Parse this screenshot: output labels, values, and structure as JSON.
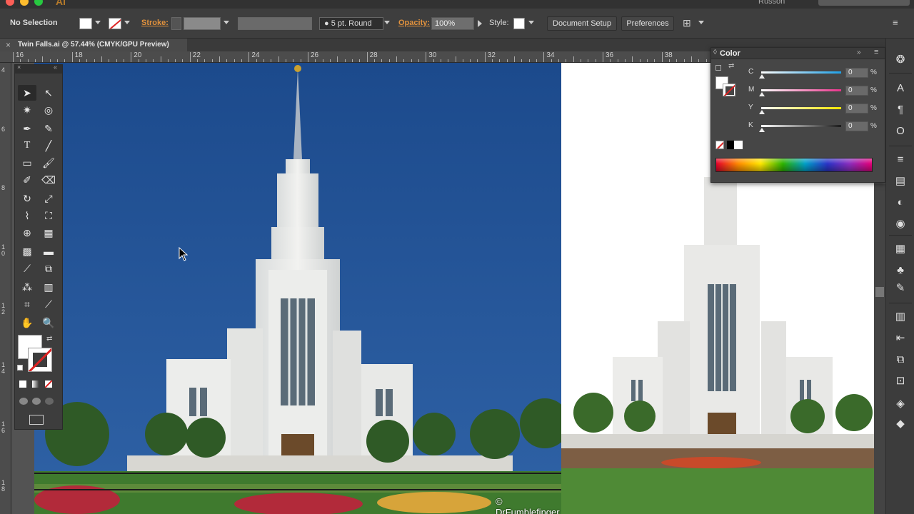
{
  "menubar": {
    "app_logo": "Ai",
    "user": "Russon"
  },
  "controlbar": {
    "selection": "No Selection",
    "stroke_label": "Stroke:",
    "brush": "5 pt. Round",
    "opacity_label": "Opacity:",
    "opacity_value": "100%",
    "style_label": "Style:",
    "document_setup": "Document Setup",
    "preferences": "Preferences"
  },
  "document": {
    "tab_title": "Twin Falls.ai @ 57.44% (CMYK/GPU Preview)",
    "close": "×"
  },
  "ruler": {
    "h_labels": [
      "16",
      "18",
      "20",
      "22",
      "24",
      "26",
      "28",
      "30",
      "32",
      "34",
      "36",
      "38"
    ],
    "v_labels": [
      "4",
      "6",
      "8",
      "1 0",
      "1 2",
      "1 4",
      "1 6",
      "1 8"
    ]
  },
  "canvas": {
    "copyright": "© DrFumblefinger"
  },
  "color_panel": {
    "title": "Color",
    "channels": [
      {
        "label": "C",
        "value": "0",
        "color": "#1ea0e6"
      },
      {
        "label": "M",
        "value": "0",
        "color": "#e8338a"
      },
      {
        "label": "Y",
        "value": "0",
        "color": "#f5e600"
      },
      {
        "label": "K",
        "value": "0",
        "color": "#1a1a1a"
      }
    ],
    "percent": "%"
  },
  "colors": {
    "sky": "#1f4f8f",
    "ui_bg": "#535353",
    "panel": "#464646",
    "accent_orange": "#e2923d"
  },
  "dock_icons": [
    "color-guide-icon",
    "character-icon",
    "paragraph-icon",
    "opentype-icon",
    "stroke-icon",
    "gradient-icon",
    "transparency-icon",
    "appearance-icon",
    "graphic-styles-icon",
    "symbols-icon",
    "brushes-icon",
    "swatches-icon",
    "align-icon",
    "pathfinder-icon",
    "transform-icon",
    "navigator-icon",
    "layers-icon"
  ]
}
